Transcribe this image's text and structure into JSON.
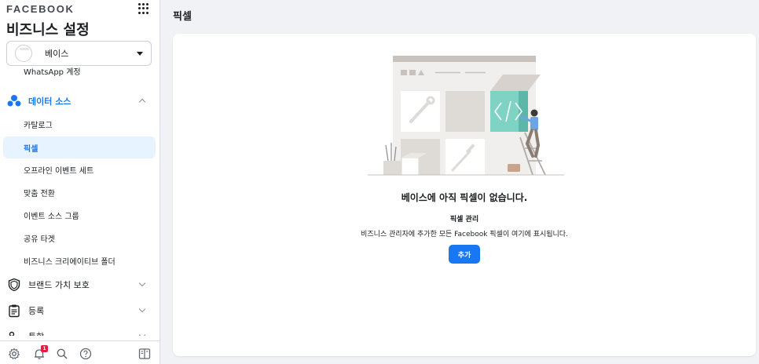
{
  "brand": "FACEBOOK",
  "settings_title": "비즈니스 설정",
  "business_selector": {
    "name": "베이스"
  },
  "sidebar": {
    "partial_item": "WhatsApp 계정",
    "data_sources": {
      "label": "데이터 소스",
      "items": [
        {
          "label": "카탈로그"
        },
        {
          "label": "픽셀",
          "active": true
        },
        {
          "label": "오프라인 이벤트 세트"
        },
        {
          "label": "맞춤 전환"
        },
        {
          "label": "이벤트 소스 그룹"
        },
        {
          "label": "공유 타겟"
        },
        {
          "label": "비즈니스 크리에이티브 폴더"
        }
      ]
    },
    "brand_safety": {
      "label": "브랜드 가치 보호"
    },
    "registrations": {
      "label": "등록"
    },
    "integrations": {
      "label": "통합"
    }
  },
  "bottom_bar": {
    "icons": [
      "settings-icon",
      "notifications-icon",
      "search-icon",
      "help-icon",
      "panel-toggle-icon"
    ],
    "notification_count": "1"
  },
  "page": {
    "title": "픽셀",
    "empty_state": {
      "title": "베이스에 아직 픽셀이 없습니다.",
      "subtitle": "픽셀 관리",
      "description": "비즈니스 관리자에 추가한 모든 Facebook 픽셀이 여기에 표시됩니다.",
      "button_label": "추가"
    }
  },
  "colors": {
    "accent": "#1877f2",
    "active_bg": "#e7f3ff",
    "badge": "#e41e3f",
    "illustration_teal": "#7fd3c4"
  }
}
